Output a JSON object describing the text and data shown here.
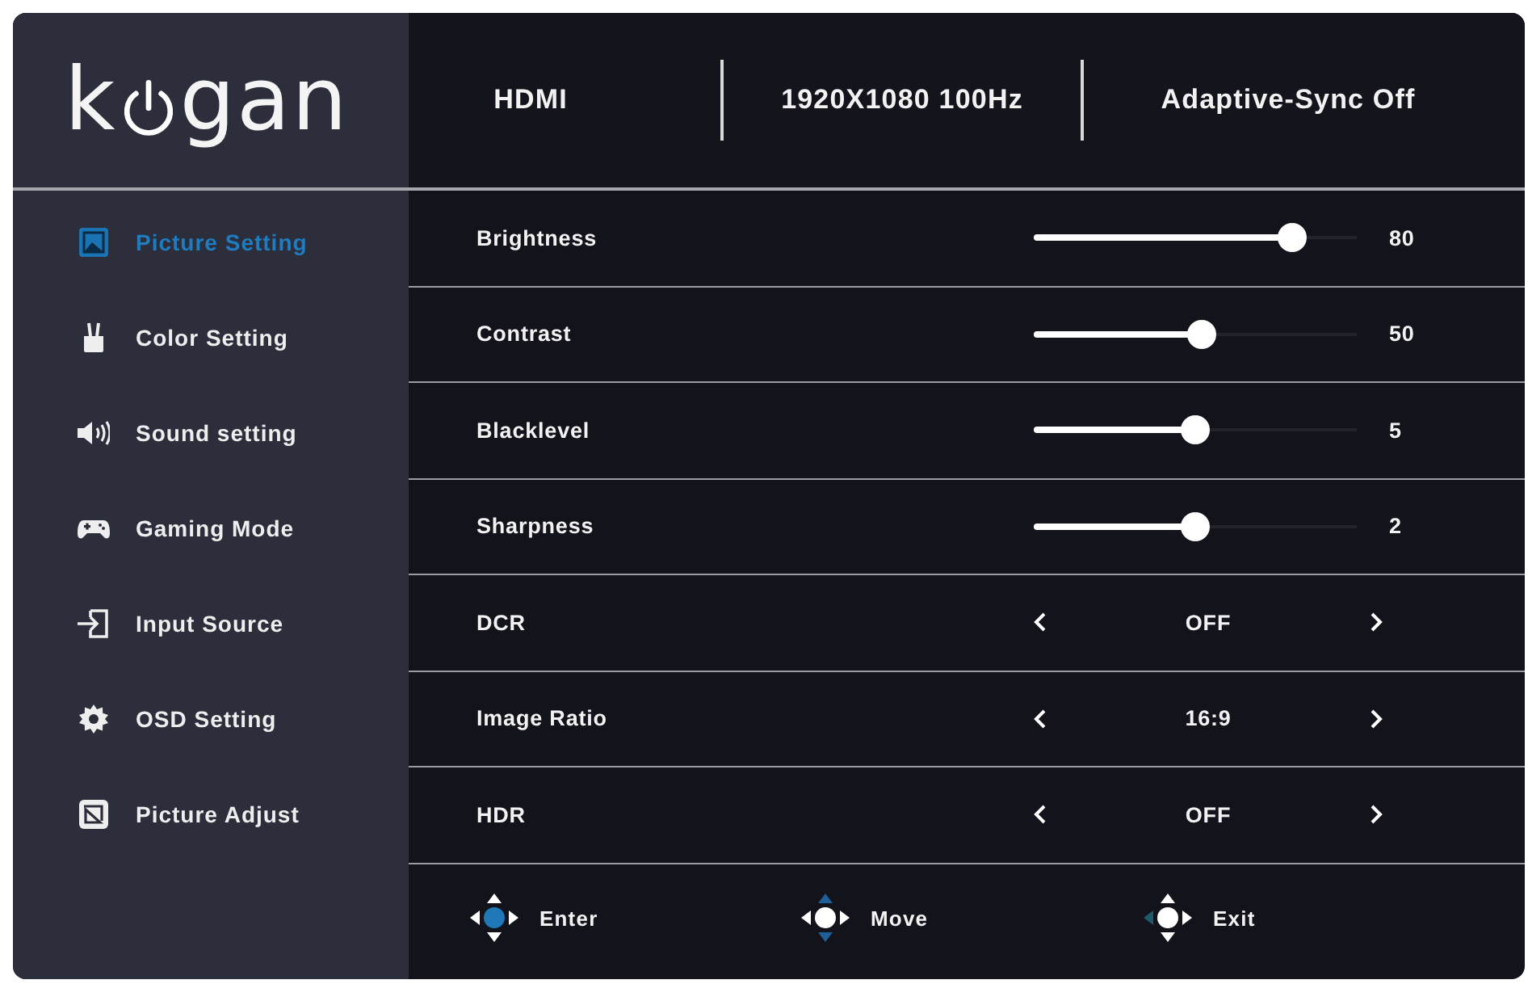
{
  "logo": {
    "text_before_icon": "k",
    "text_after_icon": "gan"
  },
  "status": [
    "HDMI",
    "1920X1080 100Hz",
    "Adaptive-Sync Off"
  ],
  "sidebar": {
    "items": [
      {
        "label": "Picture Setting",
        "selected": true
      },
      {
        "label": "Color Setting",
        "selected": false
      },
      {
        "label": "Sound setting",
        "selected": false
      },
      {
        "label": "Gaming Mode",
        "selected": false
      },
      {
        "label": "Input Source",
        "selected": false
      },
      {
        "label": "OSD Setting",
        "selected": false
      },
      {
        "label": "Picture Adjust",
        "selected": false
      }
    ]
  },
  "settings": [
    {
      "kind": "slider",
      "label": "Brightness",
      "level": 0.8,
      "value": "80"
    },
    {
      "kind": "slider",
      "label": "Contrast",
      "level": 0.52,
      "value": "50"
    },
    {
      "kind": "slider",
      "label": "Blacklevel",
      "level": 0.5,
      "value": "5"
    },
    {
      "kind": "slider",
      "label": "Sharpness",
      "level": 0.5,
      "value": "2"
    },
    {
      "kind": "choice",
      "label": "DCR",
      "value": "OFF"
    },
    {
      "kind": "choice",
      "label": "Image Ratio",
      "value": "16:9"
    },
    {
      "kind": "choice",
      "label": "HDR",
      "value": "OFF"
    }
  ],
  "footer_hints": [
    {
      "label": "Enter",
      "center_lit": true,
      "up_down_lit": false,
      "left_lit": false
    },
    {
      "label": "Move",
      "center_lit": false,
      "up_down_lit": true,
      "left_lit": false
    },
    {
      "label": "Exit",
      "center_lit": false,
      "up_down_lit": false,
      "left_lit": true
    }
  ]
}
